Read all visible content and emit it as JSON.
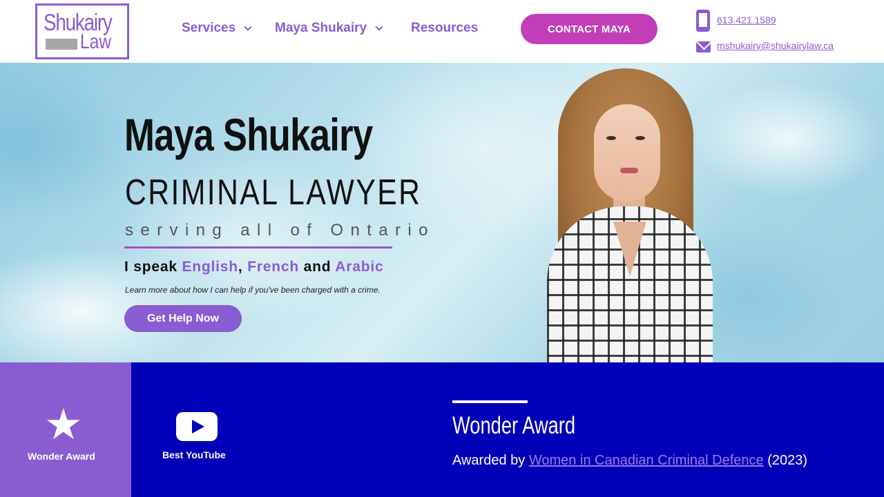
{
  "header": {
    "logo": {
      "line1": "Shukairy",
      "line2": "Law"
    },
    "nav": [
      {
        "label": "Services",
        "has_dropdown": true
      },
      {
        "label": "Maya Shukairy",
        "has_dropdown": true
      },
      {
        "label": "Resources",
        "has_dropdown": false
      }
    ],
    "cta": "CONTACT MAYA",
    "phone": "613.421.1589",
    "email": "mshukairy@shukairylaw.ca",
    "icons": {
      "phone": "phone-icon",
      "email": "envelope-icon",
      "dropdown": "chevron-down-icon"
    }
  },
  "hero": {
    "title": "Maya Shukairy",
    "subtitle": "CRIMINAL LAWYER",
    "tagline": "serving all of Ontario",
    "languages_intro": "I speak",
    "languages": [
      "English",
      "French",
      "Arabic"
    ],
    "languages_sep": ",",
    "languages_and": "and",
    "note": "Learn more about how I can help if you've been charged with a crime.",
    "button": "Get Help Now"
  },
  "awards": {
    "tabs": [
      {
        "label": "Wonder Award",
        "icon": "star-icon",
        "active": true
      },
      {
        "label": "Best YouTube",
        "icon": "youtube-play-icon",
        "active": false
      }
    ],
    "detail": {
      "title": "Wonder Award",
      "prefix": "Awarded by",
      "org": "Women in Canadian Criminal Defence",
      "year": "(2023)"
    }
  },
  "colors": {
    "brand_purple": "#8a5cd1",
    "cta_magenta": "#c13eb8",
    "awards_blue": "#0000b8",
    "white": "#ffffff"
  }
}
